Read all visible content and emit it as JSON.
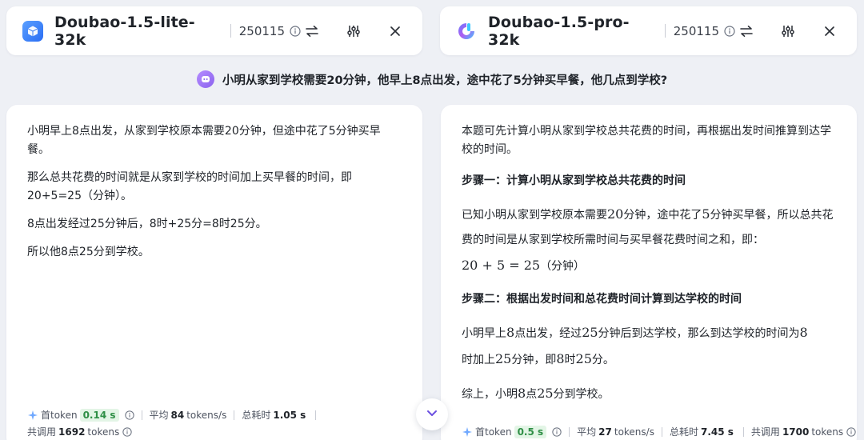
{
  "left_model": {
    "name": "Doubao-1.5-lite-32k",
    "version": "250115"
  },
  "right_model": {
    "name": "Doubao-1.5-pro-32k",
    "version": "250115"
  },
  "question": "小明从家到学校需要20分钟，他早上8点出发，途中花了5分钟买早餐，他几点到学校?",
  "left_answer": {
    "paragraphs": [
      "小明早上8点出发，从家到学校原本需要20分钟，但途中花了5分钟买早餐。",
      "那么总共花费的时间就是从家到学校的时间加上买早餐的时间，即20+5=25（分钟）。",
      "8点出发经过25分钟后，8时+25分=8时25分。",
      "所以他8点25分到学校。"
    ],
    "stats": {
      "first_token_label": "首token",
      "first_token_value": "0.14 s",
      "avg_label": "平均",
      "avg_value": "84",
      "avg_unit": "tokens/s",
      "total_time_label": "总耗时",
      "total_time_value": "1.05 s",
      "calls_label": "共调用",
      "calls_value": "1692",
      "calls_unit": "tokens"
    }
  },
  "right_answer": {
    "intro": "本题可先计算小明从家到学校总共花费的时间，再根据出发时间推算到达学校的时间。",
    "step1_title": "步骤一：计算小明从家到学校总共花费的时间",
    "step1_text_a": "已知小明从家到学校原本需要",
    "step1_num_a": "20",
    "step1_text_b": "分钟，途中花了",
    "step1_num_b": "5",
    "step1_text_c": "分钟买早餐，所以总共花费的时间是从家到学校所需时间与买早餐花费时间之和，即：",
    "step1_equation": "20 + 5 = 25",
    "step1_unit": "（分钟）",
    "step2_title": "步骤二：根据出发时间和总花费时间计算到达学校的时间",
    "step2_text_a": "小明早上",
    "step2_num_a": "8",
    "step2_text_b": "点出发，经过",
    "step2_num_b": "25",
    "step2_text_c": "分钟后到达学校，那么到达学校的时间为",
    "step2_num_c": "8",
    "step2_text_d": "时加上",
    "step2_num_d": "25",
    "step2_text_e": "分钟，即",
    "step2_num_e": "8",
    "step2_text_f": "时",
    "step2_num_f": "25",
    "step2_text_g": "分。",
    "conclusion_a": "综上，小明",
    "conclusion_num_a": "8",
    "conclusion_b": "点",
    "conclusion_num_b": "25",
    "conclusion_c": "分到学校。",
    "stats": {
      "first_token_label": "首token",
      "first_token_value": "0.5 s",
      "avg_label": "平均",
      "avg_value": "27",
      "avg_unit": "tokens/s",
      "total_time_label": "总耗时",
      "total_time_value": "7.45 s",
      "calls_label": "共调用",
      "calls_value": "1700",
      "calls_unit": "tokens"
    }
  },
  "colors": {
    "page_bg": "#eef0f5",
    "accent_green": "#2f8f46",
    "accent_purple": "#8b63ee",
    "lite_logo_blue": "#2a6df4"
  },
  "icons": [
    "cube-logo-icon",
    "doubao-pro-logo-icon",
    "info-icon",
    "swap-icon",
    "settings-sliders-icon",
    "close-icon",
    "user-avatar-icon",
    "sparkle-icon",
    "chevron-down-icon"
  ]
}
